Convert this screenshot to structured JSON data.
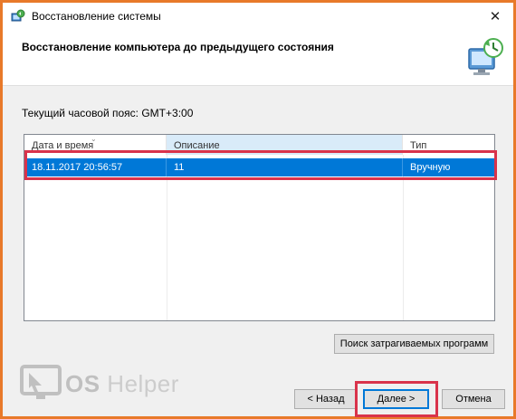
{
  "window": {
    "title": "Восстановление системы",
    "close_glyph": "✕"
  },
  "header": {
    "title": "Восстановление компьютера до предыдущего состояния",
    "icon": "system-restore-icon"
  },
  "timezone_label": "Текущий часовой пояс: GMT+3:00",
  "table": {
    "columns": [
      "Дата и время",
      "Описание",
      "Тип"
    ],
    "sorted_column": "Описание",
    "rows": [
      [
        "18.11.2017 20:56:57",
        "11",
        "Вручную"
      ]
    ],
    "selected_row": 0
  },
  "buttons": {
    "scan": "Поиск затрагиваемых программ",
    "back": "< Назад",
    "next": "Далее >",
    "cancel": "Отмена"
  },
  "watermark": {
    "part1": "OS",
    "part2": " Helper"
  },
  "colors": {
    "window_border": "#e8792a",
    "selection": "#0078d7",
    "annotation_box": "#d9334b"
  }
}
